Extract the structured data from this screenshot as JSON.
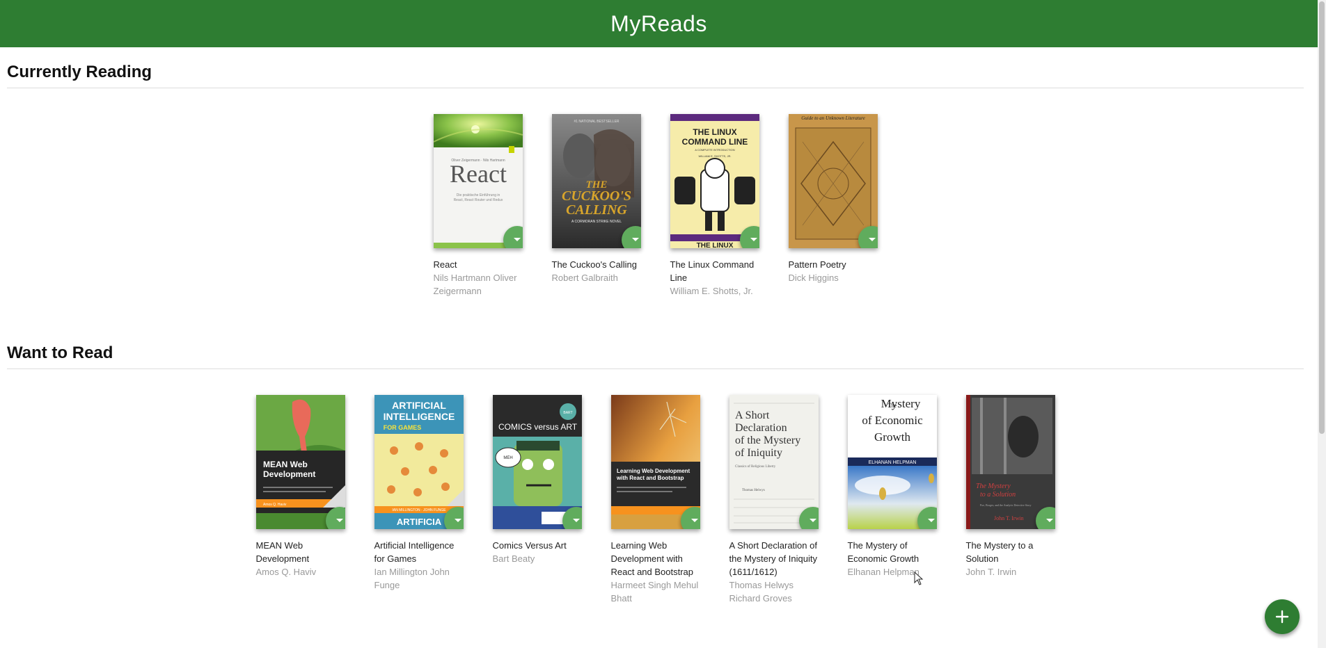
{
  "app": {
    "title": "MyReads"
  },
  "colors": {
    "header": "#2e7d32",
    "shelf_changer": "#60ac5d",
    "add_button": "#2e7d32"
  },
  "shelves": {
    "currently_reading": {
      "title": "Currently Reading",
      "books": [
        {
          "title": "React",
          "authors": "Nils Hartmann Oliver Zeigermann",
          "cover": {
            "word": "React"
          }
        },
        {
          "title": "The Cuckoo's Calling",
          "authors": "Robert Galbraith",
          "cover": {
            "word": "THE CUCKOO'S CALLING"
          }
        },
        {
          "title": "The Linux Command Line",
          "authors": "William E. Shotts, Jr.",
          "cover": {
            "word": "THE LINUX COMMAND LINE"
          }
        },
        {
          "title": "Pattern Poetry",
          "authors": "Dick Higgins",
          "cover": {
            "word": "Guide to an Unknown Literature"
          }
        }
      ]
    },
    "want_to_read": {
      "title": "Want to Read",
      "books": [
        {
          "title": "MEAN Web Development",
          "authors": "Amos Q. Haviv",
          "cover": {
            "word": "MEAN Web Development"
          }
        },
        {
          "title": "Artificial Intelligence for Games",
          "authors": "Ian Millington John Funge",
          "cover": {
            "word": "ARTIFICIAL INTELLIGENCE",
            "sub": "FOR GAMES"
          }
        },
        {
          "title": "Comics Versus Art",
          "authors": "Bart Beaty",
          "cover": {
            "word": "COMICS versus ART"
          }
        },
        {
          "title": "Learning Web Development with React and Bootstrap",
          "authors": "Harmeet Singh Mehul Bhatt",
          "cover": {
            "word": "Learning Web Development with React and Bootstrap"
          }
        },
        {
          "title": "A Short Declaration of the Mystery of Iniquity (1611/1612)",
          "authors": "Thomas Helwys Richard Groves",
          "cover": {
            "word": "A Short Declaration of the Mystery of Iniquity"
          }
        },
        {
          "title": "The Mystery of Economic Growth",
          "authors": "Elhanan Helpman",
          "cover": {
            "word": "The Mystery of Economic Growth",
            "sub": "ELHANAN HELPMAN"
          }
        },
        {
          "title": "The Mystery to a Solution",
          "authors": "John T. Irwin",
          "cover": {
            "word": "The Mystery to a Solution",
            "sub": "John T. Irwin"
          }
        }
      ]
    }
  },
  "icons": {
    "shelf_changer": "arrow-drop-down-icon",
    "add": "plus-icon"
  }
}
